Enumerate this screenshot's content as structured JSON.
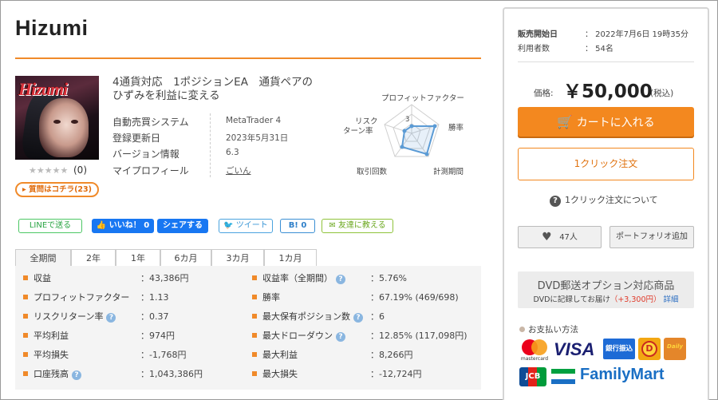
{
  "product": {
    "name": "Hizumi",
    "catch_line1": "4通貨対応　1ポジションEA　通貨ペアの",
    "catch_line2": "ひずみを利益に変える",
    "thumb_logo": "Hizumi",
    "rating_stars": "★★★★★",
    "rating_count": "(0)",
    "qa_label": "質問はコチラ(23)"
  },
  "info": [
    {
      "key": "自動売買システム",
      "value": "MetaTrader 4"
    },
    {
      "key": "登録更新日",
      "value": "2023年5月31日"
    },
    {
      "key": "バージョン情報",
      "value": "6.3"
    },
    {
      "key": "マイプロフィール",
      "value": "ごいん"
    }
  ],
  "radar": {
    "labels": {
      "profit_factor": "プロフィットファクター",
      "win_rate": "勝率",
      "period": "計測期間",
      "trades": "取引回数",
      "risk_return_1": "リスク",
      "risk_return_2": "ターン率",
      "scale": "3"
    },
    "color": "#5b9bd5"
  },
  "social": {
    "line": "LINEで送る",
    "like": "いいね！ 0",
    "share": "シェアする",
    "tweet": "ツイート",
    "hatena": "B! 0",
    "tell": "友達に教える"
  },
  "tabs": [
    "全期間",
    "2年",
    "1年",
    "6カ月",
    "3カ月",
    "1カ月"
  ],
  "stats_left": [
    {
      "label": "収益",
      "value": "：43,386円",
      "help": false
    },
    {
      "label": "プロフィットファクター",
      "value": "：1.13",
      "help": false
    },
    {
      "label": "リスクリターン率",
      "value": "：0.37",
      "help": true
    },
    {
      "label": "平均利益",
      "value": "：974円",
      "help": false
    },
    {
      "label": "平均損失",
      "value": "：-1,768円",
      "help": false
    },
    {
      "label": "口座残高",
      "value": "：1,043,386円",
      "help": true
    }
  ],
  "stats_right": [
    {
      "label": "収益率（全期間）",
      "value": "：5.76%",
      "help": true
    },
    {
      "label": "勝率",
      "value": "：67.19% (469/698)",
      "help": false
    },
    {
      "label": "最大保有ポジション数",
      "value": "：6",
      "help": true
    },
    {
      "label": "最大ドローダウン",
      "value": "：12.85% (117,098円)",
      "help": true
    },
    {
      "label": "最大利益",
      "value": "：8,266円",
      "help": false
    },
    {
      "label": "最大損失",
      "value": "：-12,724円",
      "help": false
    }
  ],
  "sale": {
    "start_key": "販売開始日",
    "start_val": "：  2022年7月6日 19時35分",
    "users_key": "利用者数",
    "users_val": "：  54名",
    "price_label": "価格:",
    "price": "￥50,000",
    "tax": "(税込)",
    "cart": "カートに入れる",
    "one_click": "1クリック注文",
    "about_one_click": "1クリック注文について",
    "fav_count": "47人",
    "portfolio": "ポートフォリオ追加",
    "dvd_title": "DVD郵送オプション対応商品",
    "dvd_sub_1": "DVDに記録してお届け",
    "dvd_sub_price": "（+3,300円）",
    "dvd_sub_link": "詳細",
    "payment_title": "お支払い方法"
  },
  "payments": {
    "mastercard": "mastercard",
    "visa": "VISA",
    "bank": "銀行振込",
    "daily1": "D",
    "daily2": "Daily",
    "jcb": "JCB",
    "familymart": "FamilyMart"
  },
  "colors": {
    "accent": "#f08a2a",
    "cart": "#f3881f",
    "facebook": "#1877f2"
  }
}
